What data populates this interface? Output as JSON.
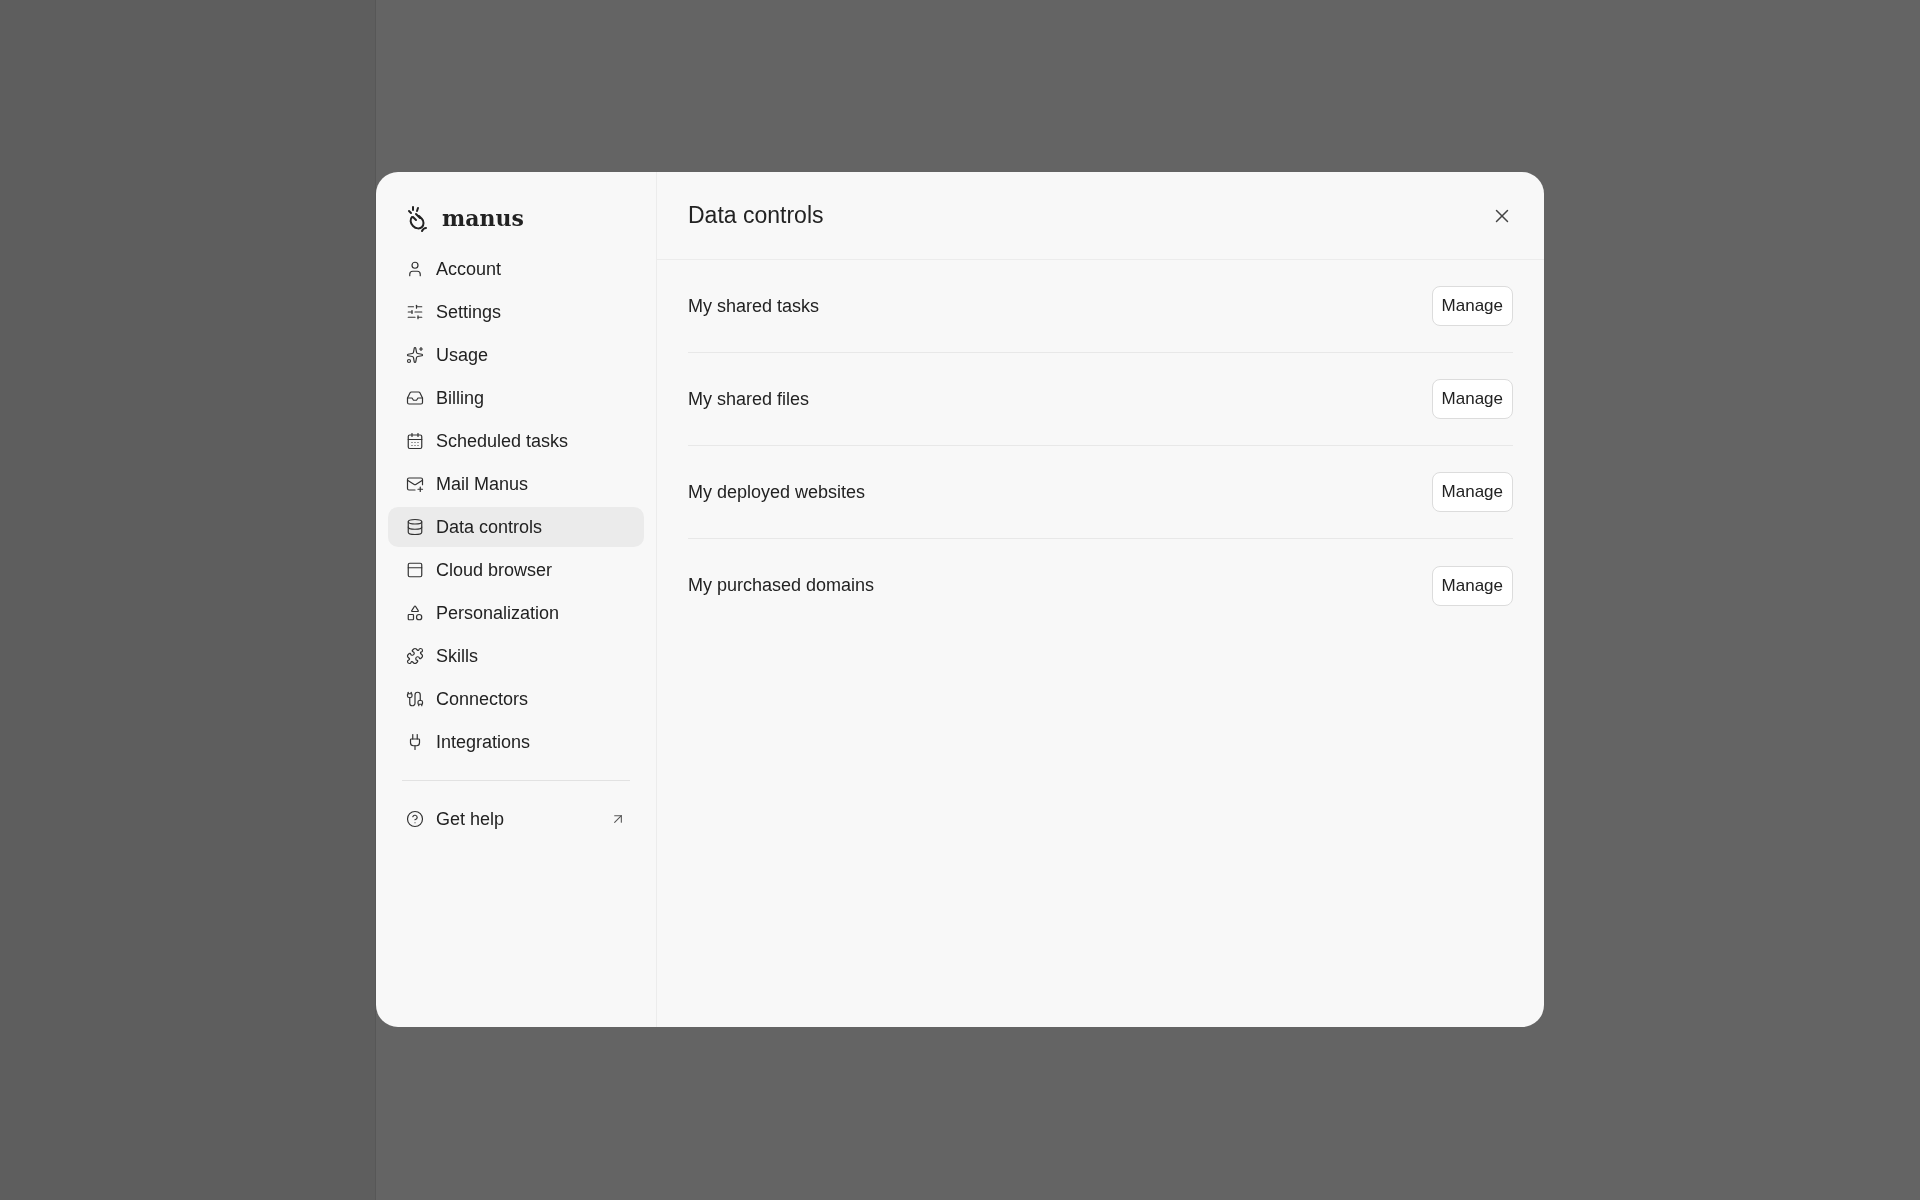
{
  "dialog": {
    "brand": "manus",
    "title": "Data controls"
  },
  "nav": [
    {
      "label": "Account",
      "selected": false
    },
    {
      "label": "Settings",
      "selected": false
    },
    {
      "label": "Usage",
      "selected": false
    },
    {
      "label": "Billing",
      "selected": false
    },
    {
      "label": "Scheduled tasks",
      "selected": false
    },
    {
      "label": "Mail Manus",
      "selected": false
    },
    {
      "label": "Data controls",
      "selected": true
    },
    {
      "label": "Cloud browser",
      "selected": false
    },
    {
      "label": "Personalization",
      "selected": false
    },
    {
      "label": "Skills",
      "selected": false
    },
    {
      "label": "Connectors",
      "selected": false
    },
    {
      "label": "Integrations",
      "selected": false
    }
  ],
  "help": {
    "label": "Get help"
  },
  "rows": [
    {
      "label": "My shared tasks",
      "button": "Manage"
    },
    {
      "label": "My shared files",
      "button": "Manage"
    },
    {
      "label": "My deployed websites",
      "button": "Manage"
    },
    {
      "label": "My purchased domains",
      "button": "Manage"
    }
  ]
}
